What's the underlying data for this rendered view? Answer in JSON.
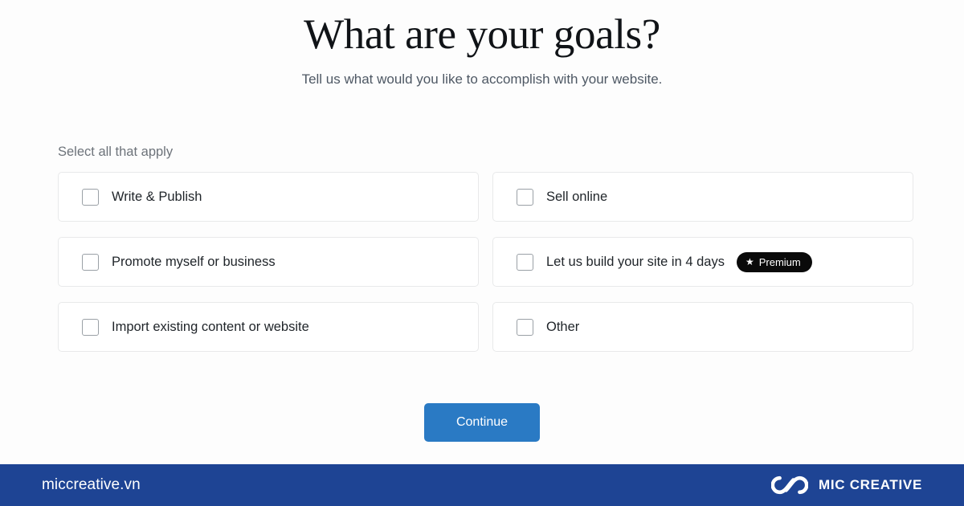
{
  "header": {
    "title": "What are your goals?",
    "subtitle": "Tell us what would you like to accomplish with your website."
  },
  "options": {
    "hint": "Select all that apply",
    "items": [
      {
        "label": "Write & Publish",
        "badge": null,
        "checked": false
      },
      {
        "label": "Sell online",
        "badge": null,
        "checked": false
      },
      {
        "label": "Promote myself or business",
        "badge": null,
        "checked": false
      },
      {
        "label": "Let us build your site in 4 days",
        "badge": "Premium",
        "badge_icon": "star-icon",
        "checked": false
      },
      {
        "label": "Import existing content or website",
        "badge": null,
        "checked": false
      },
      {
        "label": "Other",
        "badge": null,
        "checked": false
      }
    ]
  },
  "actions": {
    "continue_label": "Continue"
  },
  "footer": {
    "domain": "miccreative.vn",
    "brand_name": "MIC CREATIVE",
    "logo_icon": "infinity-loops-icon"
  },
  "colors": {
    "footer_background": "#1e4494",
    "primary_button": "#2a7ac4",
    "badge_background": "#0a0a0a",
    "card_border": "#e8e9ea",
    "title_text": "#101317",
    "subtitle_text": "#4e5864"
  }
}
